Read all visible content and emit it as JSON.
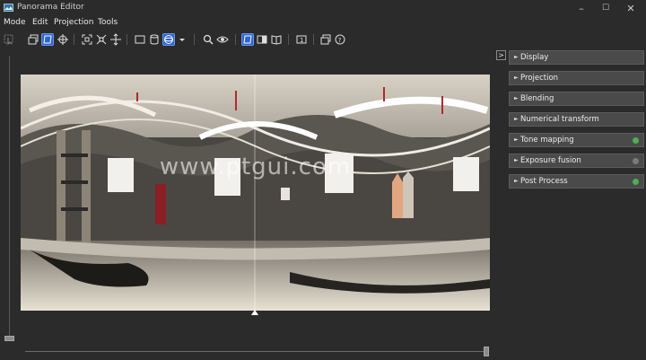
{
  "app": {
    "title": "Panorama Editor"
  },
  "window_controls": {
    "minimize": "–",
    "maximize": "☐",
    "close": "✕"
  },
  "menu": [
    "Mode",
    "Edit",
    "Projection",
    "Tools"
  ],
  "canvas": {
    "watermark": "www.ptgui.com"
  },
  "panels": [
    {
      "label": "Display",
      "indicator": null
    },
    {
      "label": "Projection",
      "indicator": null
    },
    {
      "label": "Blending",
      "indicator": null
    },
    {
      "label": "Numerical transform",
      "indicator": null
    },
    {
      "label": "Tone mapping",
      "indicator": "#4caf50"
    },
    {
      "label": "Exposure fusion",
      "indicator": "#7a7a7a"
    },
    {
      "label": "Post Process",
      "indicator": "#4caf50"
    }
  ],
  "panel_collapse_glyph": ">",
  "panel_expand_glyph": "►",
  "colors": {
    "accent": "#2d64d0",
    "status_on": "#4caf50",
    "status_off": "#7a7a7a"
  }
}
